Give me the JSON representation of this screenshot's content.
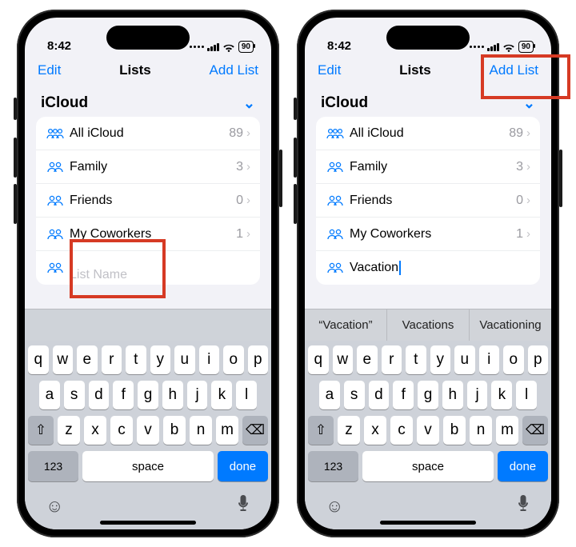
{
  "status": {
    "time": "8:42",
    "battery": "90"
  },
  "nav": {
    "edit": "Edit",
    "title": "Lists",
    "add": "Add List"
  },
  "section": {
    "title": "iCloud"
  },
  "left": {
    "rows": [
      {
        "label": "All iCloud",
        "count": "89",
        "triple": true
      },
      {
        "label": "Family",
        "count": "3"
      },
      {
        "label": "Friends",
        "count": "0"
      },
      {
        "label": "My Coworkers",
        "count": "1"
      }
    ],
    "new_placeholder": "List Name",
    "new_value": ""
  },
  "right": {
    "rows": [
      {
        "label": "All iCloud",
        "count": "89",
        "triple": true
      },
      {
        "label": "Family",
        "count": "3"
      },
      {
        "label": "Friends",
        "count": "0"
      },
      {
        "label": "My Coworkers",
        "count": "1"
      }
    ],
    "new_value": "Vacation",
    "suggestions": [
      "“Vacation”",
      "Vacations",
      "Vacationing"
    ]
  },
  "keyboard": {
    "row1": [
      "q",
      "w",
      "e",
      "r",
      "t",
      "y",
      "u",
      "i",
      "o",
      "p"
    ],
    "row2": [
      "a",
      "s",
      "d",
      "f",
      "g",
      "h",
      "j",
      "k",
      "l"
    ],
    "row3": [
      "z",
      "x",
      "c",
      "v",
      "b",
      "n",
      "m"
    ],
    "shift": "⇧",
    "backspace": "⌫",
    "k123": "123",
    "space": "space",
    "done": "done"
  },
  "colors": {
    "accent": "#007aff",
    "highlight": "#d63a24"
  }
}
